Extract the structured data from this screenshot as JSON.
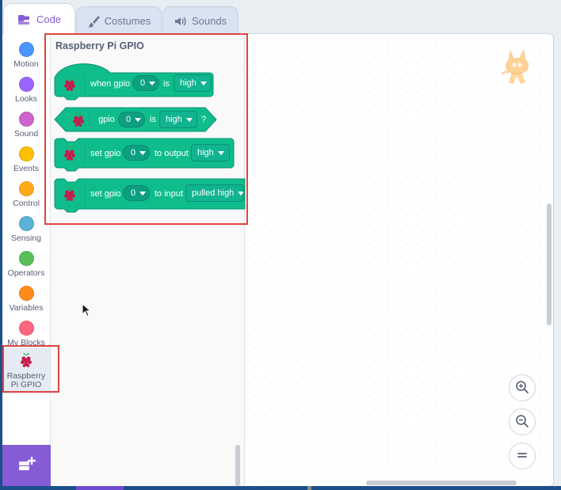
{
  "tabs": [
    {
      "label": "Code",
      "icon": "code-icon",
      "active": true
    },
    {
      "label": "Costumes",
      "icon": "paintbrush-icon",
      "active": false
    },
    {
      "label": "Sounds",
      "icon": "speaker-icon",
      "active": false
    }
  ],
  "categories": [
    {
      "label": "Motion",
      "color": "#4c97ff"
    },
    {
      "label": "Looks",
      "color": "#9966ff"
    },
    {
      "label": "Sound",
      "color": "#cf63cf"
    },
    {
      "label": "Events",
      "color": "#ffbf00"
    },
    {
      "label": "Control",
      "color": "#ffab19"
    },
    {
      "label": "Sensing",
      "color": "#5cb1d6"
    },
    {
      "label": "Operators",
      "color": "#59c059"
    },
    {
      "label": "Variables",
      "color": "#ff8c1a"
    },
    {
      "label": "My Blocks",
      "color": "#ff6680"
    },
    {
      "label": "Raspberry Pi GPIO",
      "icon": "raspberry-pi-icon",
      "selected": true
    }
  ],
  "flyout": {
    "title": "Raspberry Pi GPIO",
    "blocks": [
      {
        "type": "hat",
        "parts": [
          "when gpio",
          "0",
          "is",
          "high"
        ]
      },
      {
        "type": "boolean",
        "parts": [
          "gpio",
          "0",
          "is",
          "high",
          "?"
        ]
      },
      {
        "type": "command",
        "parts": [
          "set gpio",
          "0",
          "to output",
          "high"
        ]
      },
      {
        "type": "command",
        "parts": [
          "set gpio",
          "0",
          "to input",
          "pulled high"
        ]
      }
    ]
  },
  "colors": {
    "extension_block": "#0fbd8c",
    "extension_block_dark": "#0b9173",
    "highlight": "#e0453e",
    "accent": "#855cd6"
  },
  "workspace": {
    "zoom_controls": [
      "zoom-in-icon",
      "zoom-out-icon",
      "zoom-reset-icon"
    ],
    "sprite": "scratch-cat"
  }
}
